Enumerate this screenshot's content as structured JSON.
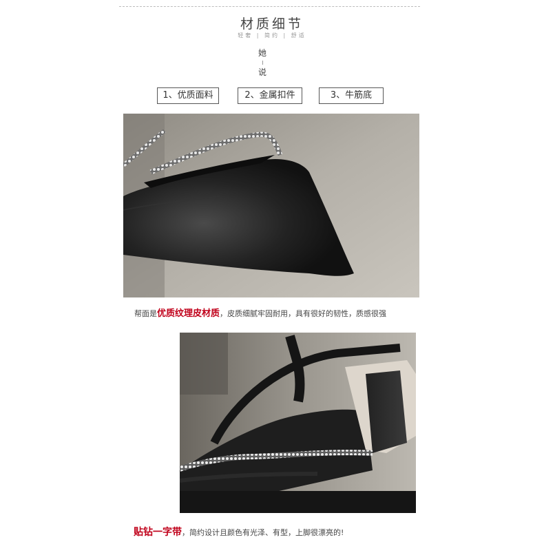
{
  "header": {
    "title": "材质细节",
    "subtitle": "轻奢 | 简约 | 舒适",
    "vertical_1": "她",
    "vertical_2": "说"
  },
  "tags": [
    "1、优质面料",
    "2、金属扣件",
    "3、牛筋底"
  ],
  "section1": {
    "caption_prefix": "帮面是",
    "caption_highlight": "优质纹理皮材质",
    "caption_suffix": "，皮质细腻牢固耐用，具有很好的韧性，质感很强"
  },
  "section2": {
    "caption_highlight": "贴钻一字带",
    "caption_suffix": "，简约设计且颜色有光泽、有型，上脚很漂亮的!"
  },
  "colors": {
    "highlight": "#c0001a",
    "leather": "#1c1c1c",
    "floor": "#a8a49c"
  }
}
